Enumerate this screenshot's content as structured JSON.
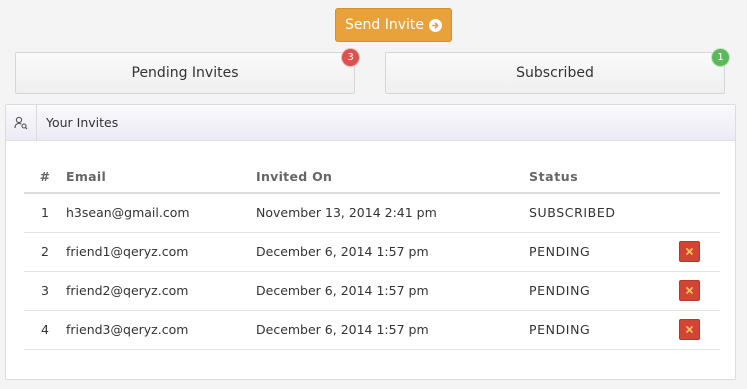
{
  "send_button": {
    "label": "Send Invite"
  },
  "tabs": [
    {
      "label": "Pending Invites",
      "badge": "3",
      "badge_color": "#d9534f"
    },
    {
      "label": "Subscribed",
      "badge": "1",
      "badge_color": "#5cb85c"
    }
  ],
  "panel": {
    "title": "Your Invites"
  },
  "table": {
    "headers": {
      "num": "#",
      "email": "Email",
      "invited_on": "Invited On",
      "status": "Status"
    },
    "rows": [
      {
        "num": "1",
        "email": "h3sean@gmail.com",
        "invited_on": "November 13, 2014 2:41 pm",
        "status": "SUBSCRIBED",
        "deletable": false
      },
      {
        "num": "2",
        "email": "friend1@qeryz.com",
        "invited_on": "December 6, 2014 1:57 pm",
        "status": "PENDING",
        "deletable": true
      },
      {
        "num": "3",
        "email": "friend2@qeryz.com",
        "invited_on": "December 6, 2014 1:57 pm",
        "status": "PENDING",
        "deletable": true
      },
      {
        "num": "4",
        "email": "friend3@qeryz.com",
        "invited_on": "December 6, 2014 1:57 pm",
        "status": "PENDING",
        "deletable": true
      }
    ]
  },
  "colors": {
    "accent": "#e9a23b",
    "delete": "#d24433"
  },
  "icons": {
    "send": "arrow-circle-right-icon",
    "panel": "user-search-icon",
    "delete": "close-icon"
  }
}
